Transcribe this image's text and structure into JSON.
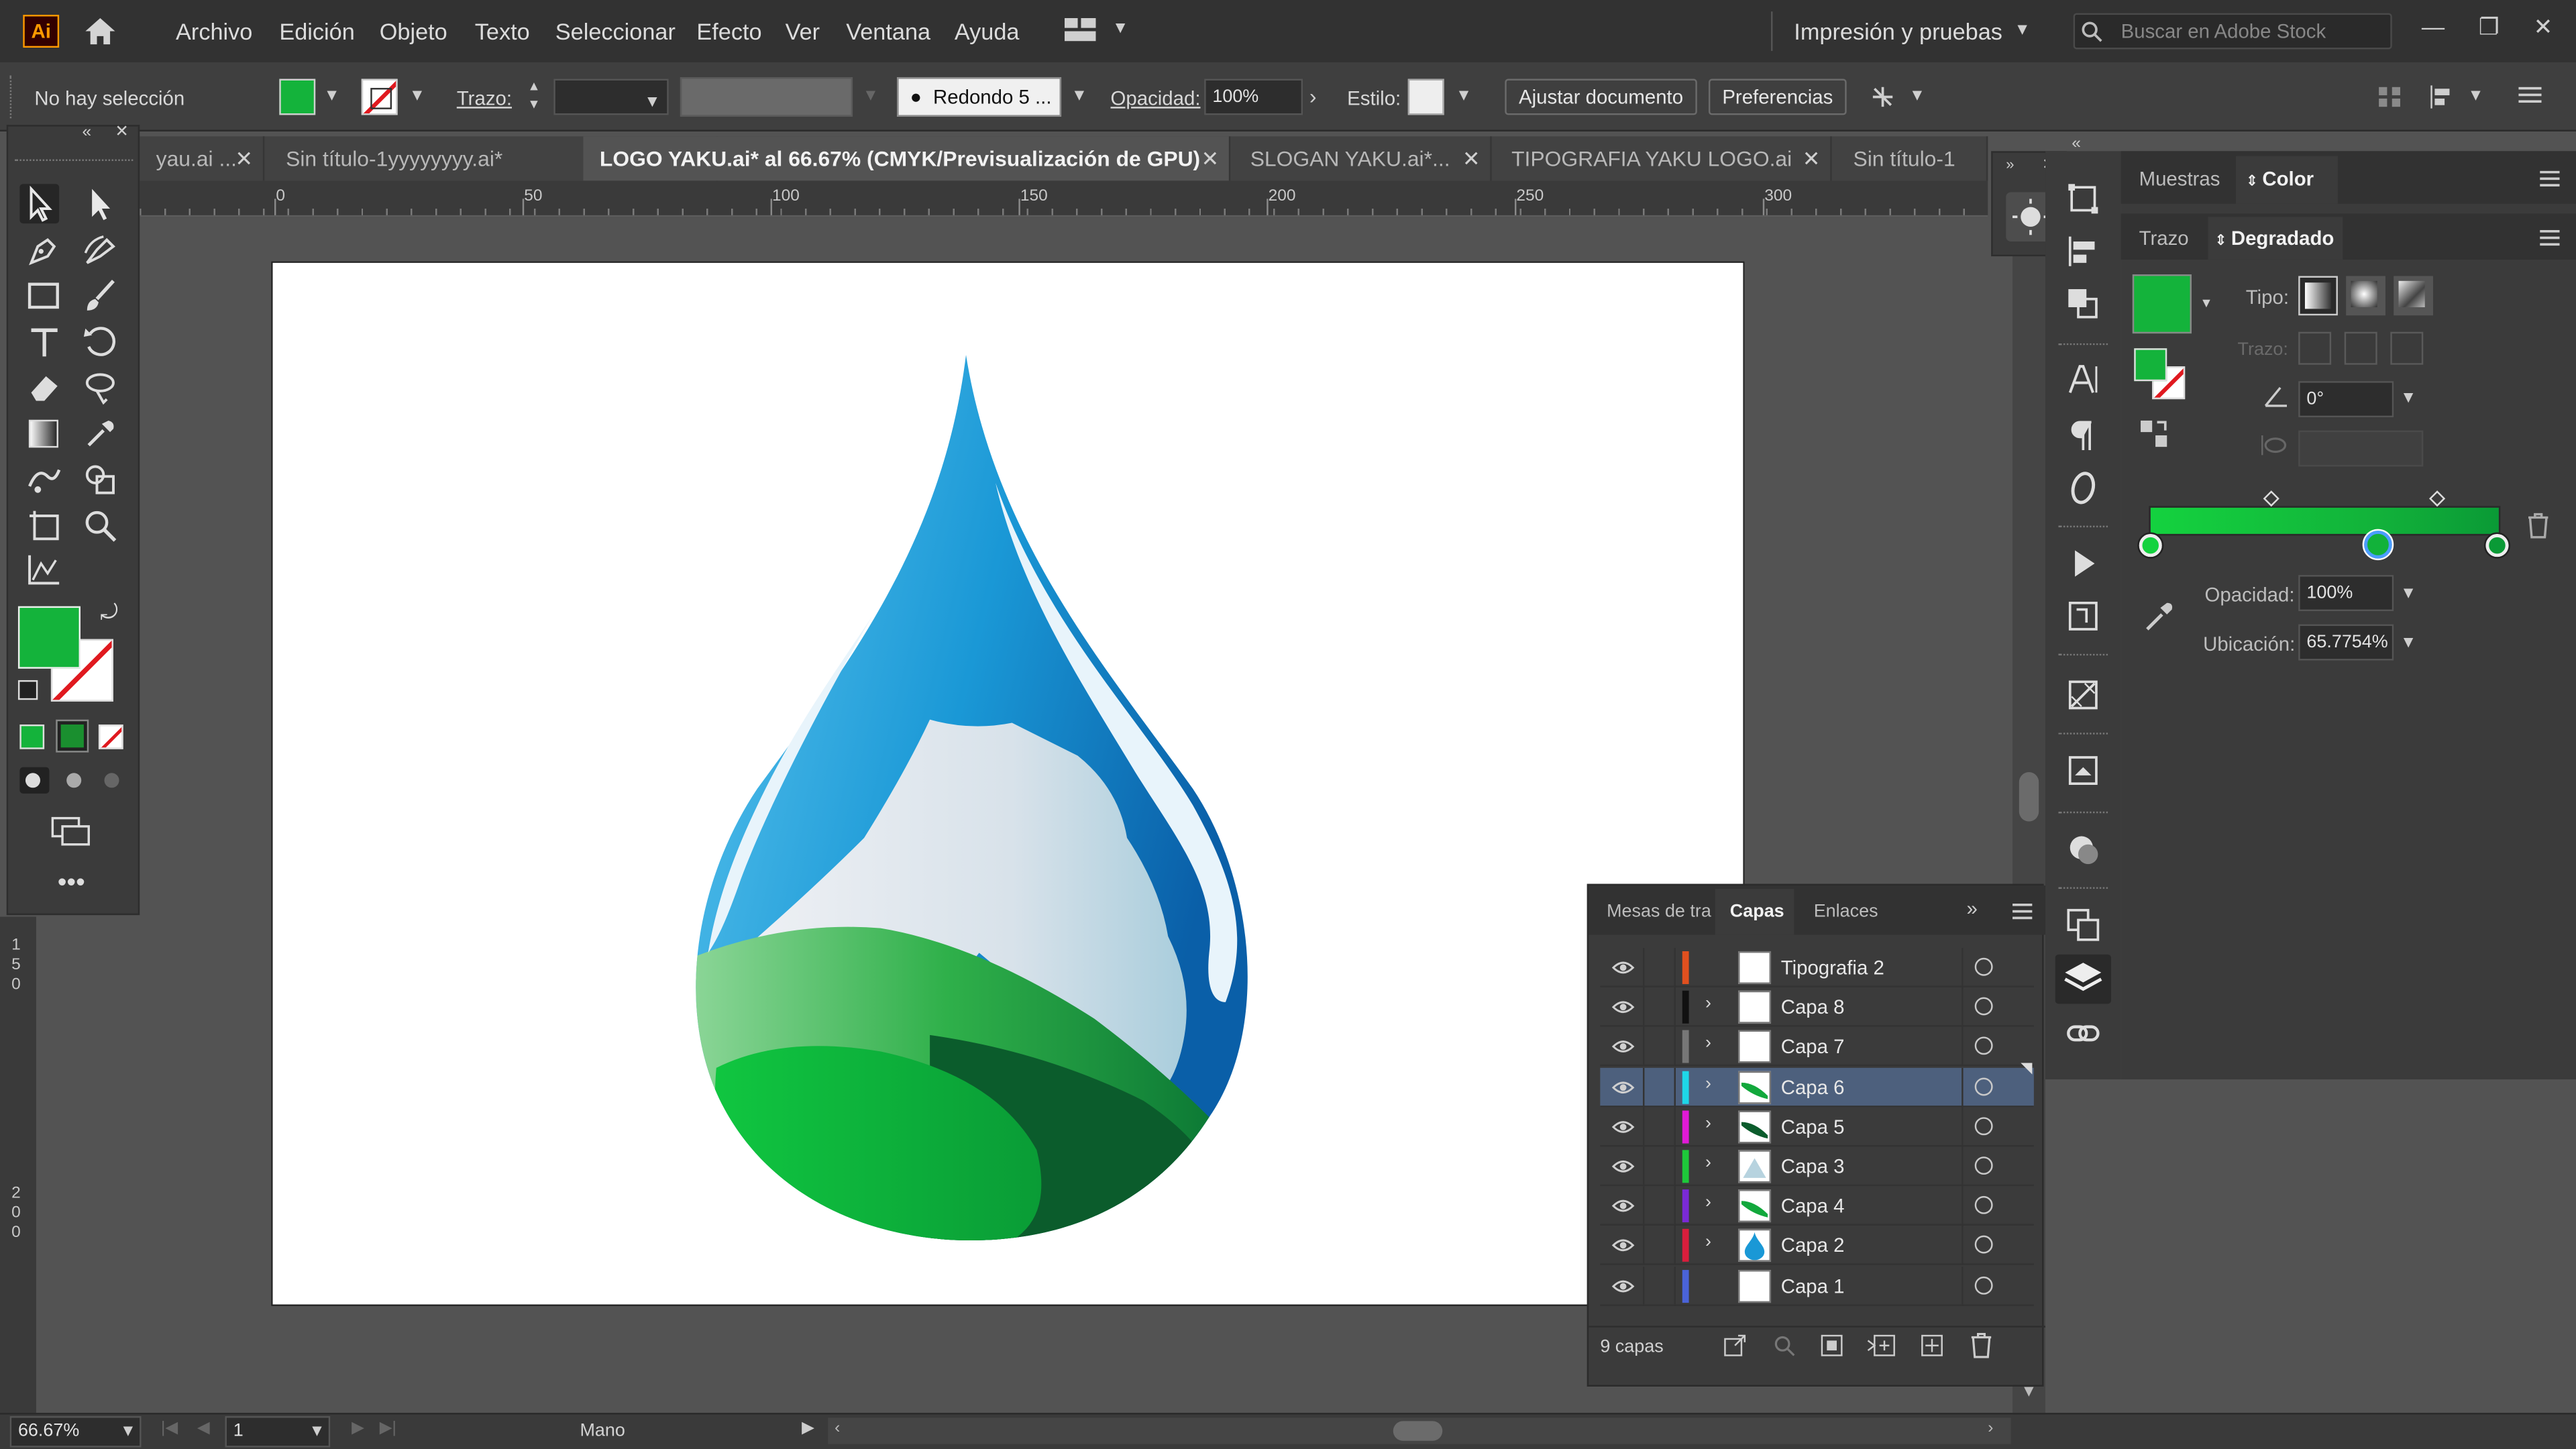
{
  "app": {
    "logo": "Ai"
  },
  "menu": [
    "Archivo",
    "Edición",
    "Objeto",
    "Texto",
    "Seleccionar",
    "Efecto",
    "Ver",
    "Ventana",
    "Ayuda"
  ],
  "workspace": "Impresión y pruebas",
  "search": {
    "placeholder": "Buscar en Adobe Stock"
  },
  "control_bar": {
    "selection": "No hay selección",
    "stroke_label": "Trazo:",
    "brush": "Redondo 5 ...",
    "opacity_label": "Opacidad:",
    "opacity": "100%",
    "style_label": "Estilo:",
    "fit_document": "Ajustar documento",
    "preferences": "Preferencias"
  },
  "tabs": [
    {
      "label": "yau.ai ...",
      "active": false
    },
    {
      "label": "Sin título-1yyyyyyyy.ai*",
      "active": false
    },
    {
      "label": "LOGO YAKU.ai* al 66.67% (CMYK/Previsualización de GPU)",
      "active": true
    },
    {
      "label": "SLOGAN YAKU.ai*...",
      "active": false
    },
    {
      "label": "TIPOGRAFIA YAKU LOGO.ai",
      "active": false
    },
    {
      "label": "Sin título-1",
      "active": false
    }
  ],
  "ruler_h": [
    "0",
    "50",
    "100",
    "150",
    "200",
    "250",
    "300"
  ],
  "ruler_v": [
    "1\n5\n0",
    "2\n0\n0"
  ],
  "color_panel": {
    "tabs": [
      "Muestras",
      "Color"
    ],
    "subtabs": [
      "Trazo",
      "Degradado"
    ],
    "type_label": "Tipo:",
    "stroke_label": "Trazo:",
    "angle": "0°",
    "opacity_label": "Opacidad:",
    "opacity": "100%",
    "location_label": "Ubicación:",
    "location": "65.7754%"
  },
  "layers_panel": {
    "tabs": [
      "Mesas de tra",
      "Capas",
      "Enlaces"
    ],
    "count": "9 capas",
    "layers": [
      {
        "name": "Tipografia 2",
        "color": "#e0501f",
        "expandable": false,
        "selected": false,
        "thumb": "white"
      },
      {
        "name": "Capa 8",
        "color": "#111111",
        "expandable": true,
        "selected": false,
        "thumb": "white"
      },
      {
        "name": "Capa 7",
        "color": "#777777",
        "expandable": true,
        "selected": false,
        "thumb": "white"
      },
      {
        "name": "Capa 6",
        "color": "#1ed7e8",
        "expandable": true,
        "selected": true,
        "thumb": "leaf"
      },
      {
        "name": "Capa 5",
        "color": "#e01ad6",
        "expandable": true,
        "selected": false,
        "thumb": "dark-leaf"
      },
      {
        "name": "Capa 3",
        "color": "#1ec83a",
        "expandable": true,
        "selected": false,
        "thumb": "mountain"
      },
      {
        "name": "Capa 4",
        "color": "#7a2ad6",
        "expandable": true,
        "selected": false,
        "thumb": "leaf"
      },
      {
        "name": "Capa 2",
        "color": "#d91e3c",
        "expandable": true,
        "selected": false,
        "thumb": "drop"
      },
      {
        "name": "Capa 1",
        "color": "#4a63d8",
        "expandable": false,
        "selected": false,
        "thumb": "white"
      }
    ]
  },
  "status_bar": {
    "zoom": "66.67%",
    "artboard": "1",
    "tool": "Mano"
  },
  "colors": {
    "fill": "#14b33b",
    "accent": "#4b9dff",
    "selected_layer": "#4d607d"
  }
}
